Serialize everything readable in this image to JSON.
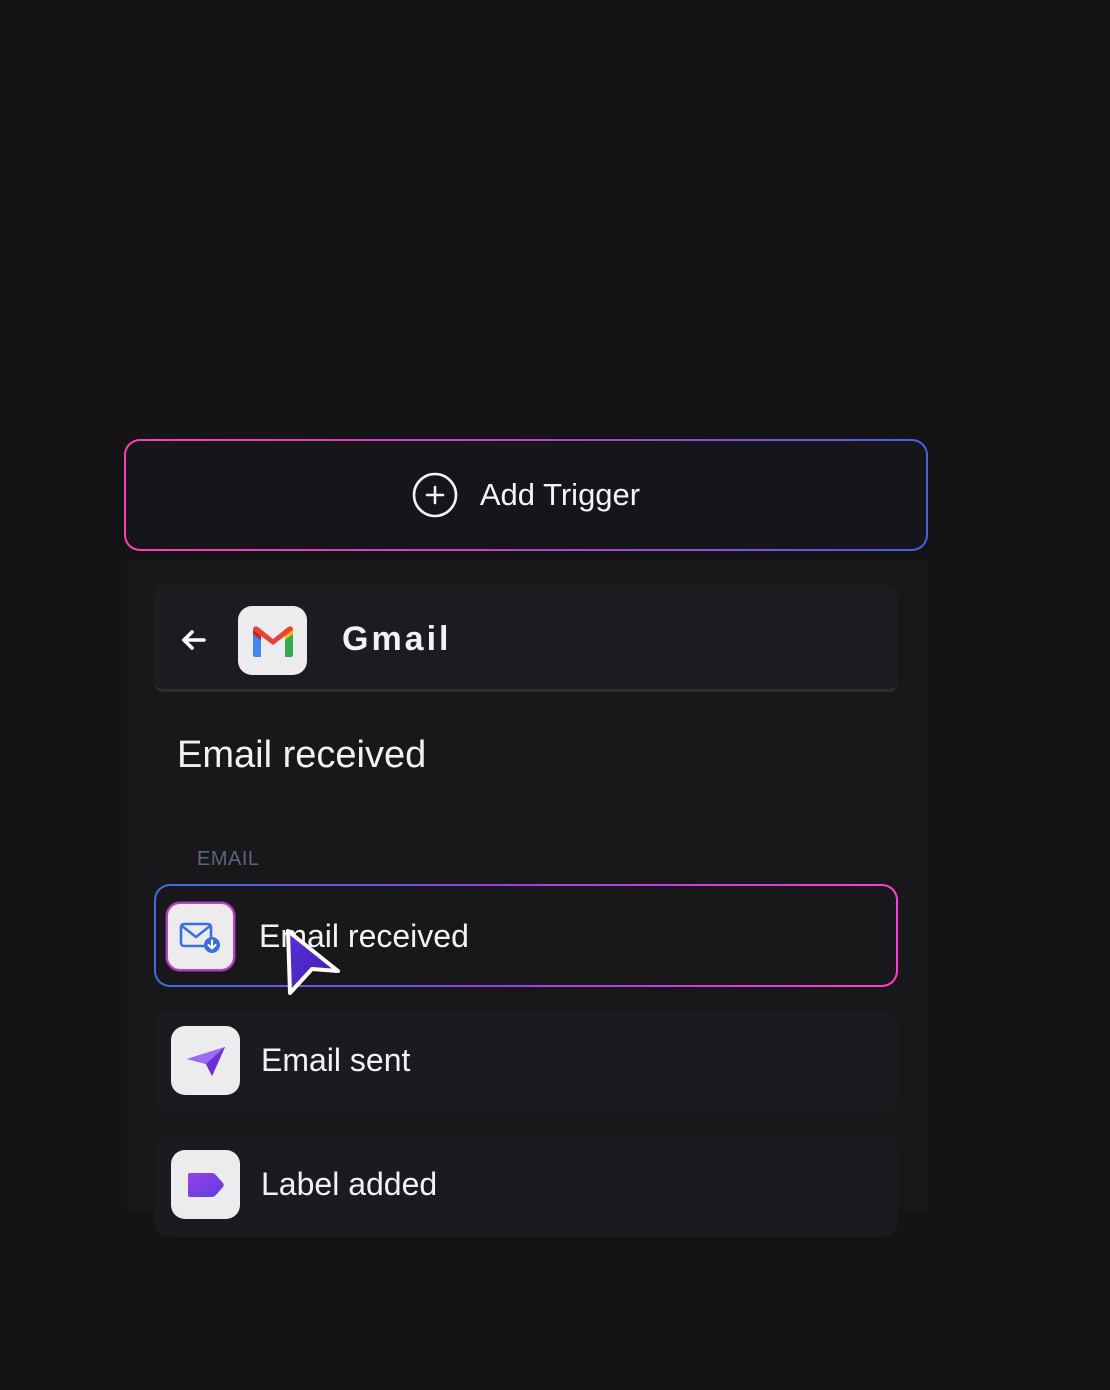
{
  "trigger": {
    "label": "Add Trigger"
  },
  "header": {
    "app_title": "Gmail"
  },
  "section": {
    "heading": "Email received"
  },
  "group": {
    "label": "EMAIL"
  },
  "items": [
    {
      "label": "Email received",
      "icon": "mail-download-icon",
      "selected": true
    },
    {
      "label": "Email sent",
      "icon": "paper-plane-icon",
      "selected": false
    },
    {
      "label": "Label added",
      "icon": "label-tag-icon",
      "selected": false
    }
  ],
  "colors": {
    "background": "#141417",
    "panel": "#18181b",
    "accent_pink": "#ff3fb0",
    "accent_blue": "#4b5fe0",
    "accent_purple": "#7b3fe4",
    "group_label": "#5b6480"
  }
}
